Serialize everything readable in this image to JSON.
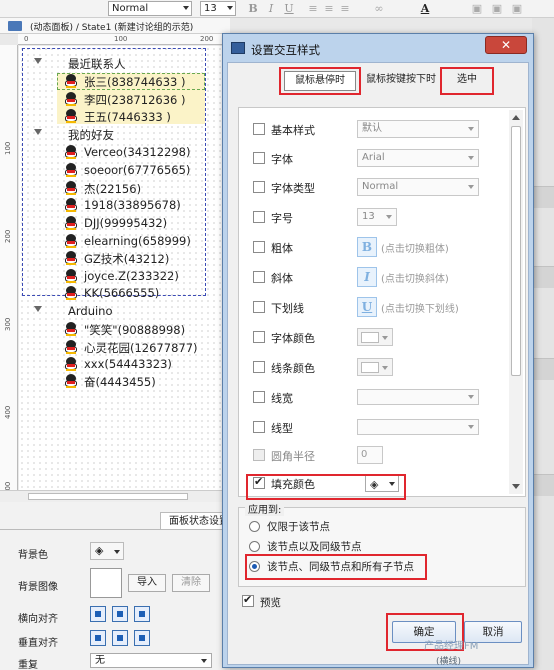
{
  "toolbar": {
    "style_value": "Normal",
    "font_size_value": "13",
    "bold_label": "B",
    "italic_label": "I",
    "underline_label": "U",
    "font_color_label": "A"
  },
  "canvas": {
    "header_title": "(动态面板) / State1 (新建讨论组的示范)",
    "ruler_top": [
      "0",
      "100",
      "200"
    ],
    "ruler_left": [
      "100",
      "200",
      "300",
      "400",
      "500"
    ],
    "groups": [
      {
        "label": "最近联系人",
        "items": [
          "张三(838744633 )",
          "李四(238712636 )",
          "王五(7446333 )"
        ]
      },
      {
        "label": "我的好友",
        "items": [
          "Verceo(34312298)",
          "soeoor(67776565)",
          "杰(22156)",
          "1918(33895678)",
          "DJJ(99995432)",
          "elearning(658999)",
          "GZ技术(43212)",
          "joyce.Z(233322)",
          "KK(5666555)"
        ]
      },
      {
        "label": "Arduino",
        "items": [
          "\"笑笑\"(90888998)",
          "心灵花园(12677877)",
          "xxx(54443323)",
          "奋(4443455)"
        ]
      }
    ]
  },
  "left_panel": {
    "tab_label": "面板状态设置",
    "bg_color_label": "背景色",
    "bg_image_label": "背景图像",
    "import_label": "导入",
    "clear_label": "清除",
    "h_align_label": "横向对齐",
    "v_align_label": "垂直对齐",
    "repeat_label": "重复",
    "repeat_value": "无"
  },
  "dialog": {
    "title": "设置交互样式",
    "close_label": "✕",
    "tabs": [
      "鼠标悬停时",
      "鼠标按键按下时",
      "选中"
    ],
    "rows": [
      {
        "label": "基本样式",
        "kind": "select",
        "value": "默认"
      },
      {
        "label": "字体",
        "kind": "select",
        "value": "Arial"
      },
      {
        "label": "字体类型",
        "kind": "select",
        "value": "Normal"
      },
      {
        "label": "字号",
        "kind": "select-short",
        "value": "13"
      },
      {
        "label": "粗体",
        "kind": "button",
        "glyph": "B",
        "hint": "(点击切换粗体)"
      },
      {
        "label": "斜体",
        "kind": "button",
        "glyph": "I",
        "hint": "(点击切换斜体)"
      },
      {
        "label": "下划线",
        "kind": "button",
        "glyph": "U",
        "hint": "(点击切换下划线)"
      },
      {
        "label": "字体颜色",
        "kind": "color"
      },
      {
        "label": "线条颜色",
        "kind": "color"
      },
      {
        "label": "线宽",
        "kind": "line"
      },
      {
        "label": "线型",
        "kind": "line"
      },
      {
        "label": "圆角半径",
        "kind": "input",
        "value": "0"
      },
      {
        "label": "填充颜色",
        "kind": "fill",
        "checked": true
      }
    ],
    "apply_legend": "应用到:",
    "apply_options": [
      "仅限于该节点",
      "该节点以及同级节点",
      "该节点、同级节点和所有子节点"
    ],
    "apply_selected": 2,
    "preview_label": "预览",
    "ok_label": "确定",
    "cancel_label": "取消"
  },
  "watermark": {
    "text": "产品经理FM",
    "sub": "(横线)"
  },
  "colors": {
    "highlight_red": "#e0262e",
    "selection_blue": "#1c5ab3",
    "row_highlight": "#fbf3c8"
  }
}
